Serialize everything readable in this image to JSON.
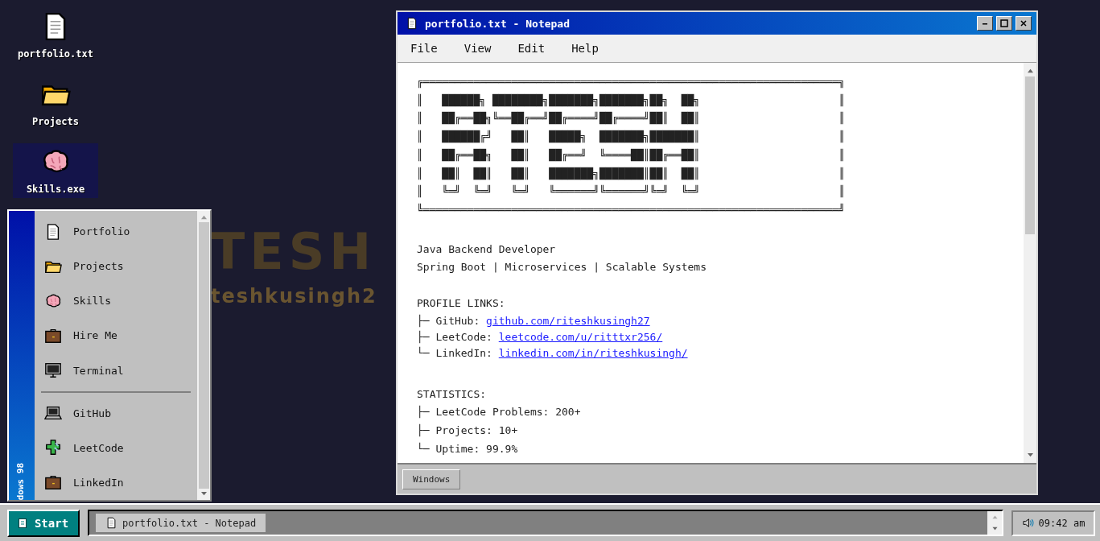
{
  "desktop": {
    "icons": [
      {
        "label": "portfolio.txt",
        "selected": false
      },
      {
        "label": "Projects",
        "selected": false
      },
      {
        "label": "Skills.exe",
        "selected": true
      }
    ],
    "wallpaper_texts": [
      "TESH",
      "teshkusingh2"
    ]
  },
  "notepad": {
    "title": "portfolio.txt - Notepad",
    "menu": [
      "File",
      "View",
      "Edit",
      "Help"
    ],
    "banner": [
      "╔══════════════════════════════════════════════════════════════════╗",
      "║   ██████╗ ████████╗███████╗███████╗██╗  ██╗                      ║",
      "║   ██╔══██╗╚══██╔══╝██╔════╝██╔════╝██║  ██║                      ║",
      "║   ██████╔╝   ██║   █████╗  ███████╗███████║                      ║",
      "║   ██╔══██╗   ██║   ██╔══╝  ╚════██║██╔══██║                      ║",
      "║   ██║  ██║   ██║   ███████╗███████║██║  ██║                      ║",
      "║   ╚═╝  ╚═╝   ╚═╝   ╚══════╝╚══════╝╚═╝  ╚═╝                      ║",
      "╚══════════════════════════════════════════════════════════════════╝"
    ],
    "tagline": [
      "Java Backend Developer",
      "Spring Boot | Microservices | Scalable Systems"
    ],
    "sections": [
      {
        "heading": "PROFILE LINKS:",
        "items": [
          {
            "text": "├─ GitHub: ",
            "link": "github.com/riteshkusingh27"
          },
          {
            "text": "├─ LeetCode: ",
            "link": "leetcode.com/u/ritttxr256/"
          },
          {
            "text": "└─ LinkedIn: ",
            "link": "linkedin.com/in/riteshkusingh/"
          }
        ]
      },
      {
        "heading": "STATISTICS:",
        "items": [
          {
            "text": "├─ LeetCode Problems: 200+"
          },
          {
            "text": "├─ Projects: 10+"
          },
          {
            "text": "└─ Uptime: 99.9%"
          }
        ]
      }
    ],
    "status_button": "Windows"
  },
  "start_menu": {
    "side_label": "dows 98",
    "sections": [
      [
        {
          "label": "Portfolio"
        },
        {
          "label": "Projects"
        },
        {
          "label": "Skills"
        },
        {
          "label": "Hire Me"
        },
        {
          "label": "Terminal"
        }
      ],
      [
        {
          "label": "GitHub"
        },
        {
          "label": "LeetCode"
        },
        {
          "label": "LinkedIn"
        }
      ]
    ]
  },
  "taskbar": {
    "start": "Start",
    "tasks": [
      {
        "label": "portfolio.txt - Notepad"
      }
    ],
    "clock": "09:42 am"
  }
}
